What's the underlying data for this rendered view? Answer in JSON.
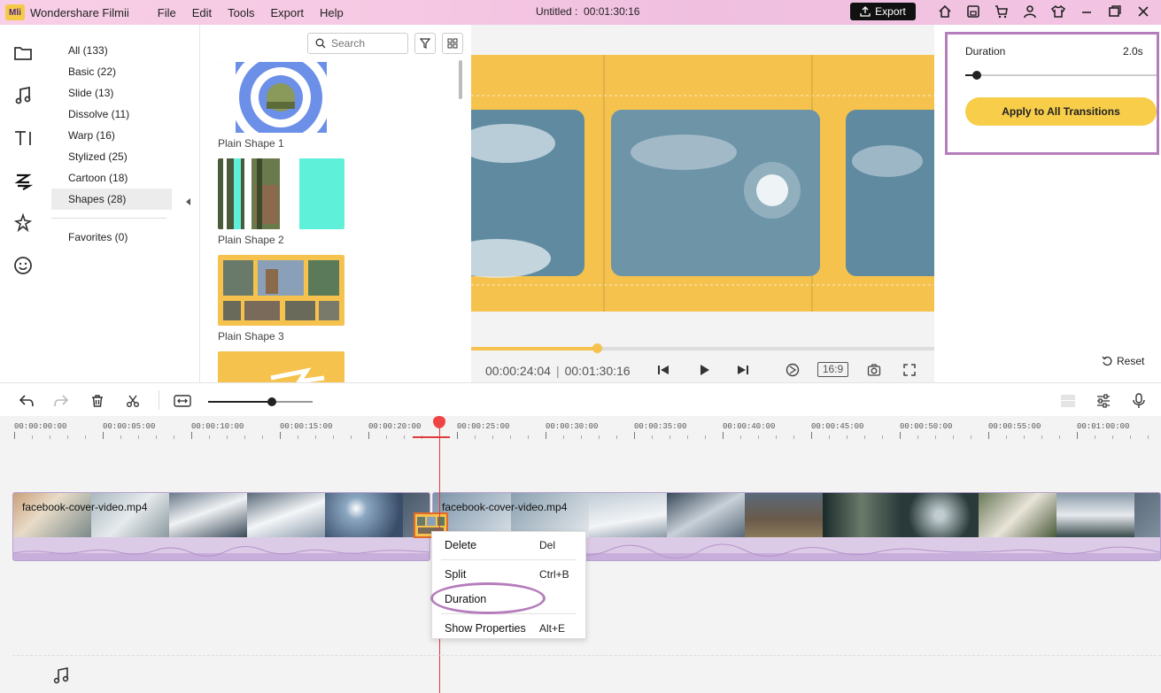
{
  "app": {
    "logo_text": "Mli",
    "name": "Wondershare Filmii",
    "menu": [
      "File",
      "Edit",
      "Tools",
      "Export",
      "Help"
    ],
    "doc_title": "Untitled :",
    "doc_duration": "00:01:30:16",
    "export_label": "Export"
  },
  "categories": [
    {
      "label": "All (133)"
    },
    {
      "label": "Basic (22)"
    },
    {
      "label": "Slide (13)"
    },
    {
      "label": "Dissolve (11)"
    },
    {
      "label": "Warp (16)"
    },
    {
      "label": "Stylized (25)"
    },
    {
      "label": "Cartoon (18)"
    },
    {
      "label": "Shapes (28)",
      "active": true
    }
  ],
  "favorites_label": "Favorites (0)",
  "search": {
    "placeholder": "Search"
  },
  "thumbnails": [
    {
      "label": "Plain Shape 1"
    },
    {
      "label": "Plain Shape 2"
    },
    {
      "label": "Plain Shape 3"
    }
  ],
  "preview": {
    "current_time": "00:00:24:04",
    "total_time": "00:01:30:16",
    "aspect_ratio": "16:9",
    "progress": 0.27
  },
  "properties": {
    "duration_label": "Duration",
    "duration_value": "2.0s",
    "apply_label": "Apply to All Transitions",
    "reset_label": "Reset"
  },
  "timeline": {
    "ruler_labels": [
      "00:00:00:00",
      "00:00:05:00",
      "00:00:10:00",
      "00:00:15:00",
      "00:00:20:00",
      "00:00:25:00",
      "00:00:30:00",
      "00:00:35:00",
      "00:00:40:00",
      "00:00:45:00",
      "00:00:50:00",
      "00:00:55:00",
      "00:01:00:00"
    ],
    "clips": [
      {
        "name": "facebook-cover-video.mp4"
      },
      {
        "name": "facebook-cover-video.mp4"
      }
    ]
  },
  "context_menu": {
    "items": [
      {
        "label": "Delete",
        "shortcut": "Del"
      },
      {
        "label": "Split",
        "shortcut": "Ctrl+B"
      },
      {
        "label": "Duration",
        "shortcut": ""
      },
      {
        "label": "Show Properties",
        "shortcut": "Alt+E"
      }
    ]
  }
}
